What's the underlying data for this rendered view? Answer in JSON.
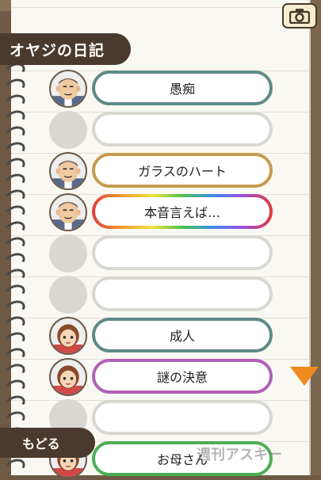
{
  "header": {
    "title": "オヤジの日記"
  },
  "camera": {
    "icon": "camera-icon"
  },
  "entries": [
    {
      "label": "愚痴",
      "avatar": "father",
      "border": "teal"
    },
    {
      "label": "",
      "avatar": "empty",
      "border": "gray"
    },
    {
      "label": "ガラスのハート",
      "avatar": "father",
      "border": "gold"
    },
    {
      "label": "本音言えば…",
      "avatar": "father",
      "border": "rainbow"
    },
    {
      "label": "",
      "avatar": "empty",
      "border": "gray"
    },
    {
      "label": "",
      "avatar": "empty",
      "border": "gray"
    },
    {
      "label": "成人",
      "avatar": "girl",
      "border": "teal"
    },
    {
      "label": "謎の決意",
      "avatar": "girl",
      "border": "purple"
    },
    {
      "label": "",
      "avatar": "empty",
      "border": "gray"
    },
    {
      "label": "お母さん",
      "avatar": "girl",
      "border": "green"
    }
  ],
  "footer": {
    "back_label": "もどる"
  },
  "watermark": "週刊アスキー",
  "colors": {
    "teal": "#5e8a86",
    "gold": "#c59c4e",
    "purple": "#b060b6",
    "green": "#4cae55",
    "scroll_arrow": "#f08a1e",
    "tab_bg": "#4a3a2d"
  }
}
